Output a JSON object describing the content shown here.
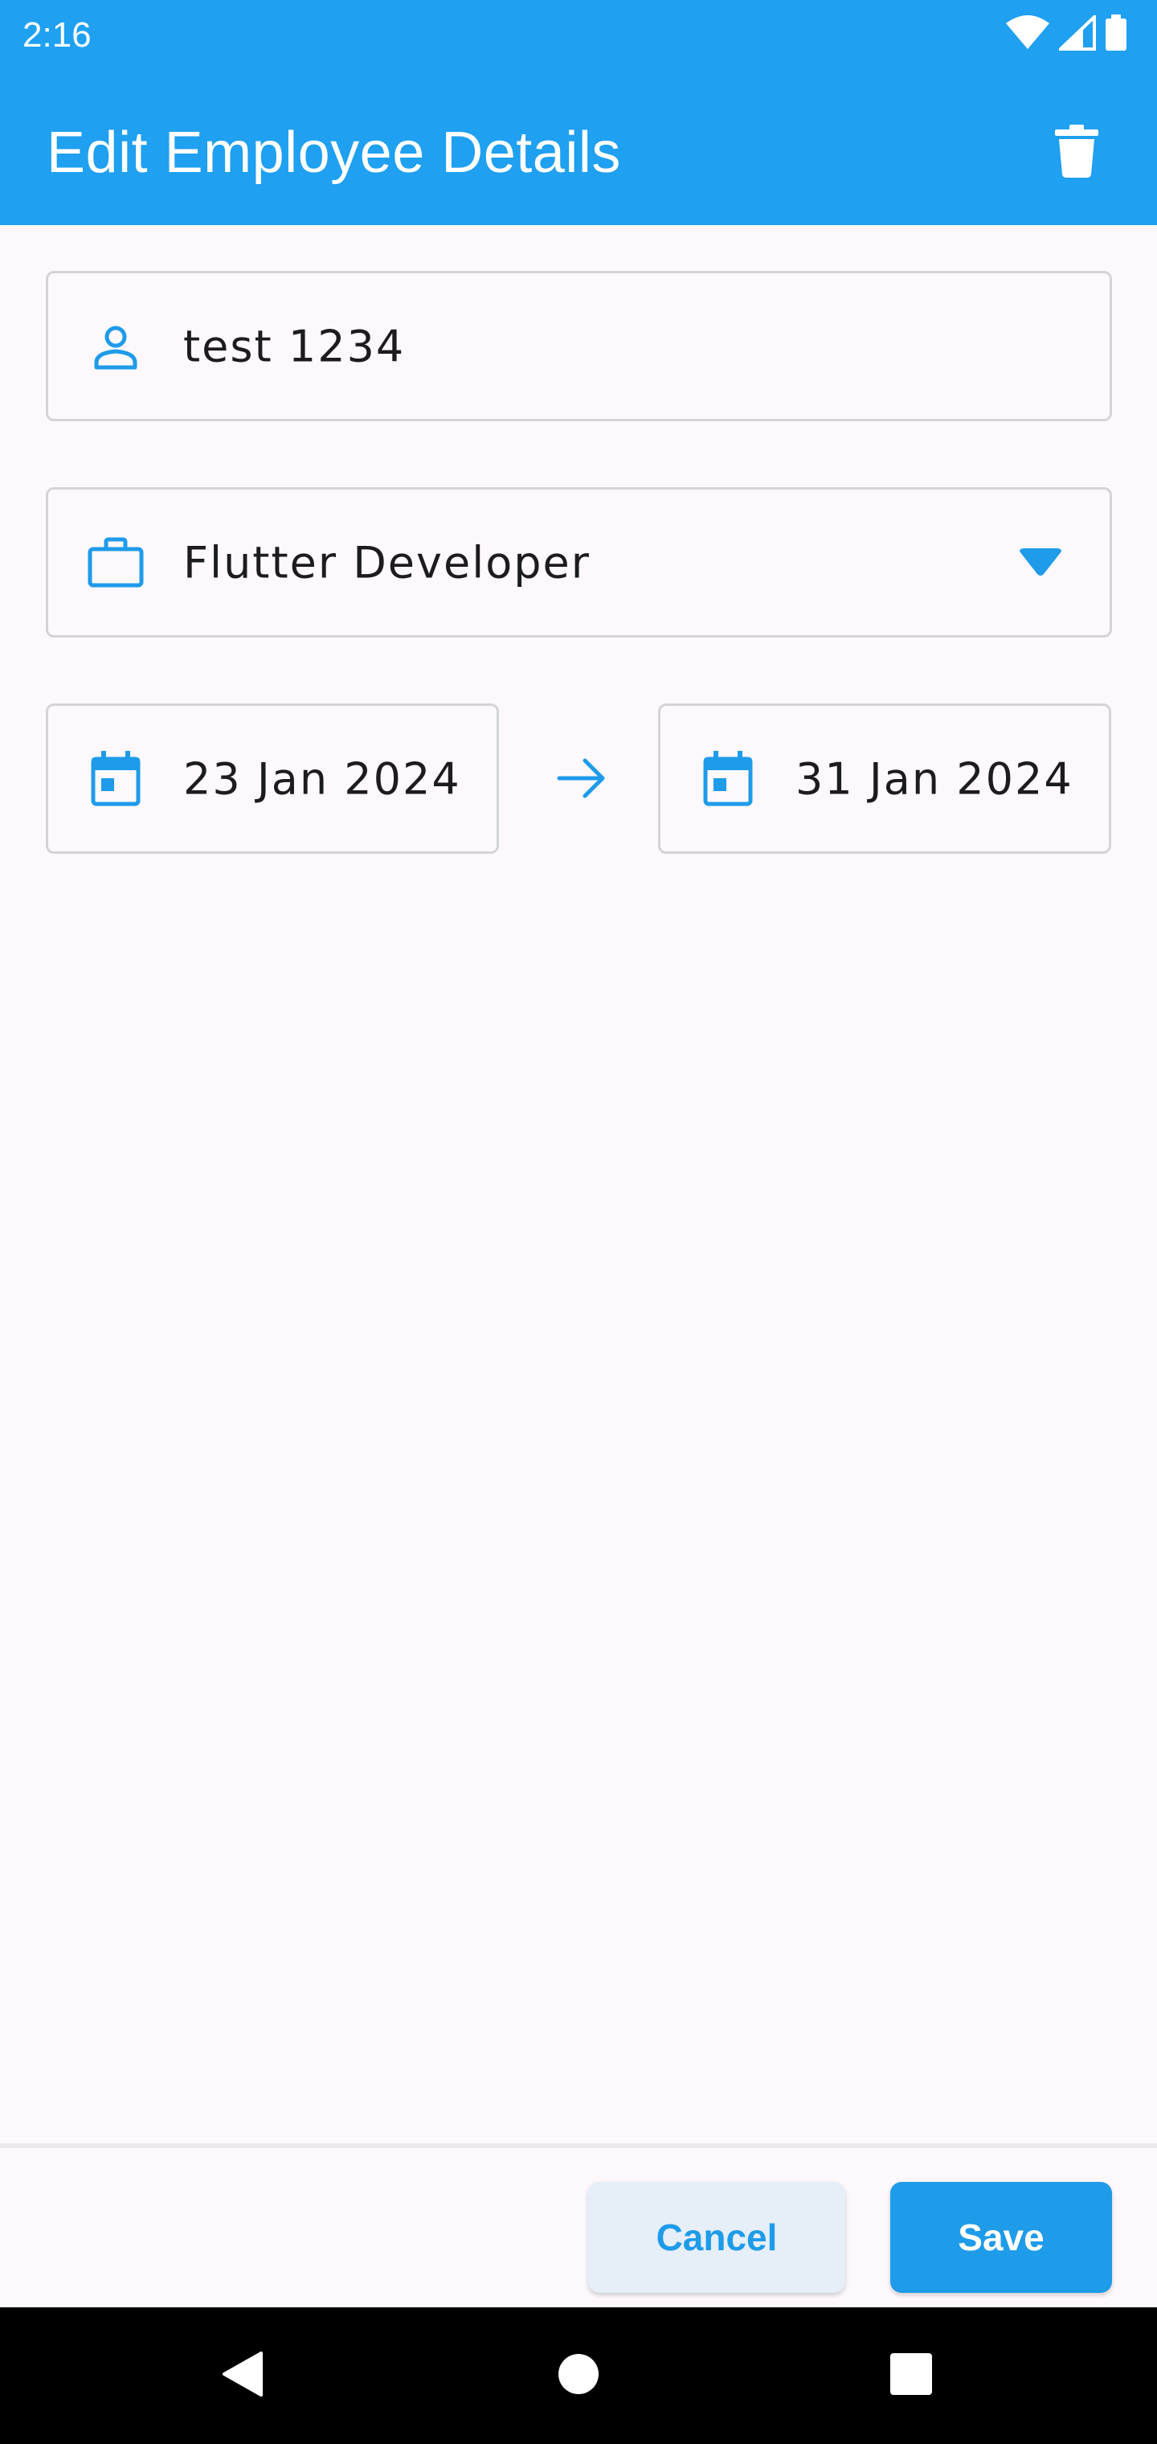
{
  "status_bar": {
    "time": "2:16",
    "icons": [
      "wifi-icon",
      "signal-icon",
      "battery-icon"
    ]
  },
  "app_bar": {
    "title": "Edit Employee Details",
    "action_icon": "delete-icon"
  },
  "form": {
    "employee_name": {
      "value": "test 1234",
      "icon": "person-icon"
    },
    "role": {
      "selected": "Flutter Developer",
      "icon": "briefcase-icon",
      "dropdown_icon": "caret-down-icon"
    },
    "start_date": {
      "value": "23 Jan 2024",
      "icon": "calendar-icon"
    },
    "separator_icon": "arrow-right-icon",
    "end_date": {
      "value": "31 Jan 2024",
      "icon": "calendar-icon"
    }
  },
  "actions": {
    "cancel_label": "Cancel",
    "save_label": "Save"
  },
  "nav_bar": {
    "buttons": [
      "back-icon",
      "home-icon",
      "recents-icon"
    ]
  },
  "colors": {
    "primary": "#1FA0F0",
    "background": "#FDF8FC",
    "cancel_bg": "#E6EEF7",
    "field_border": "#D4D4D8"
  }
}
